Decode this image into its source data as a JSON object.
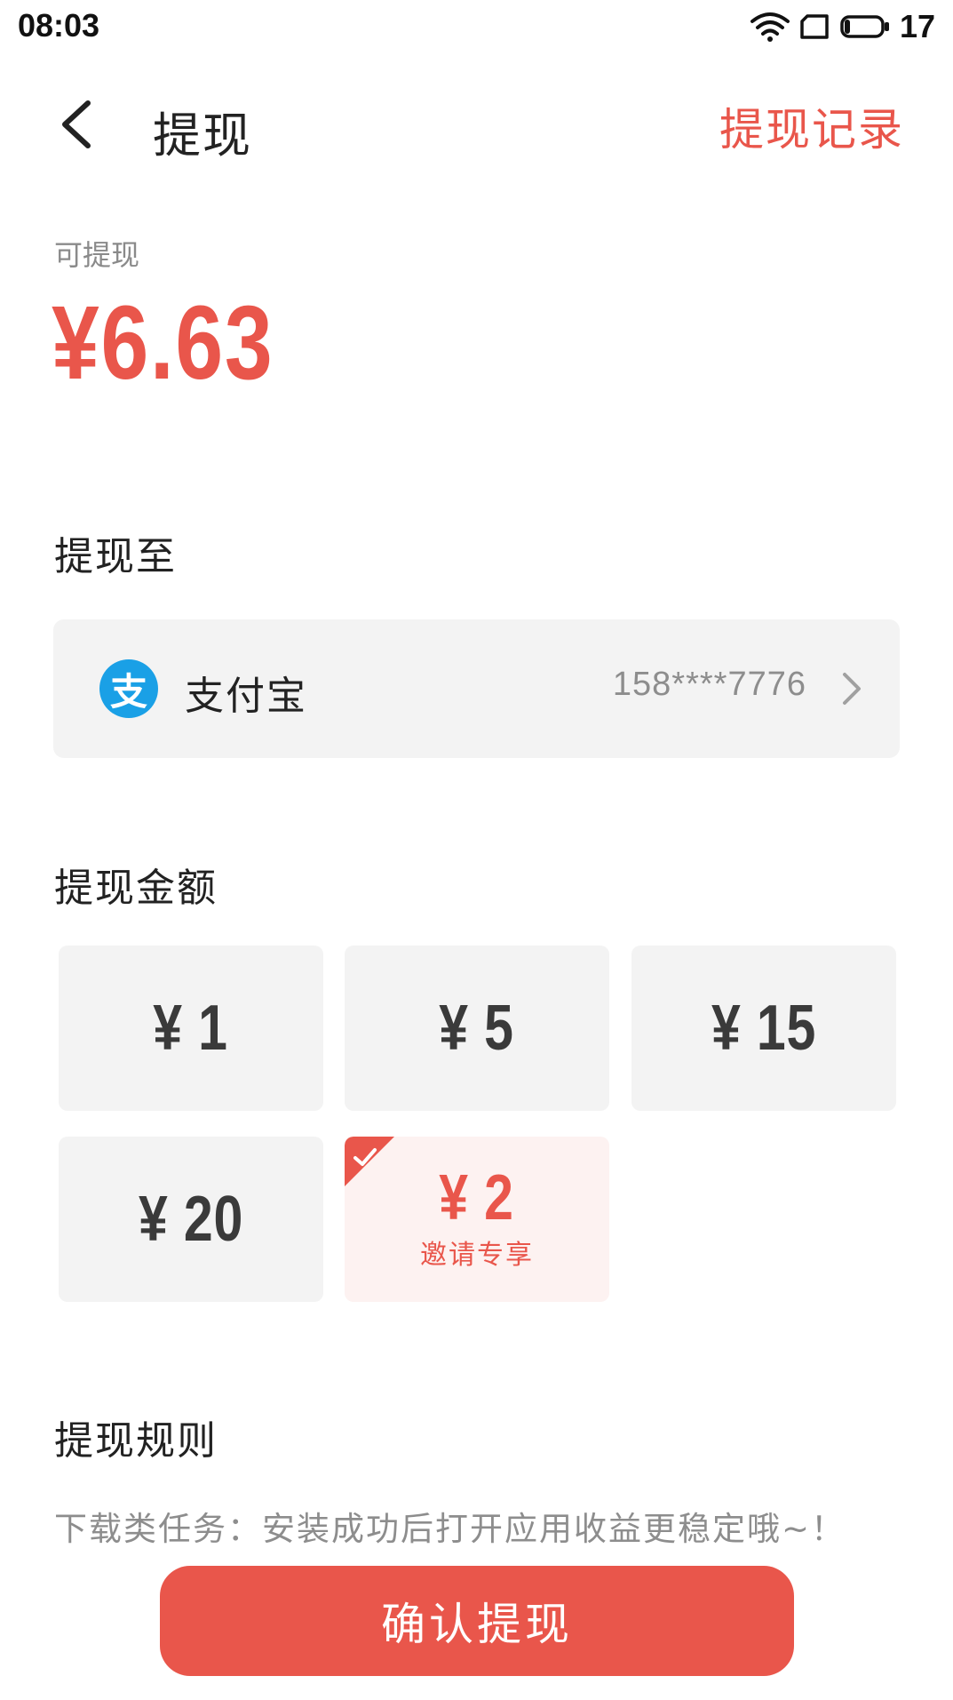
{
  "status_bar": {
    "time": "08:03",
    "battery": "17",
    "icons": [
      "wifi-icon",
      "sim-icon",
      "battery-icon"
    ]
  },
  "header": {
    "title": "提现",
    "record_link": "提现记录",
    "back_icon": "chevron-left-icon"
  },
  "balance": {
    "label": "可提现",
    "amount": "¥6.63"
  },
  "withdraw_to": {
    "title": "提现至",
    "method_name": "支付宝",
    "method_icon_glyph": "支",
    "account": "158****7776"
  },
  "amounts": {
    "title": "提现金额",
    "options": [
      {
        "value": "¥ 1",
        "tag": ""
      },
      {
        "value": "¥ 5",
        "tag": ""
      },
      {
        "value": "¥ 15",
        "tag": ""
      },
      {
        "value": "¥ 20",
        "tag": ""
      },
      {
        "value": "¥ 2",
        "tag": "邀请专享"
      }
    ],
    "selected_index": 4
  },
  "rules": {
    "title": "提现规则",
    "text": "下载类任务：安装成功后打开应用收益更稳定哦~！"
  },
  "confirm_button": "确认提现",
  "colors": {
    "accent": "#E9564B",
    "card_bg": "#F3F3F3",
    "selected_bg": "#FDF2F1",
    "alipay_blue": "#1AA0E6"
  }
}
